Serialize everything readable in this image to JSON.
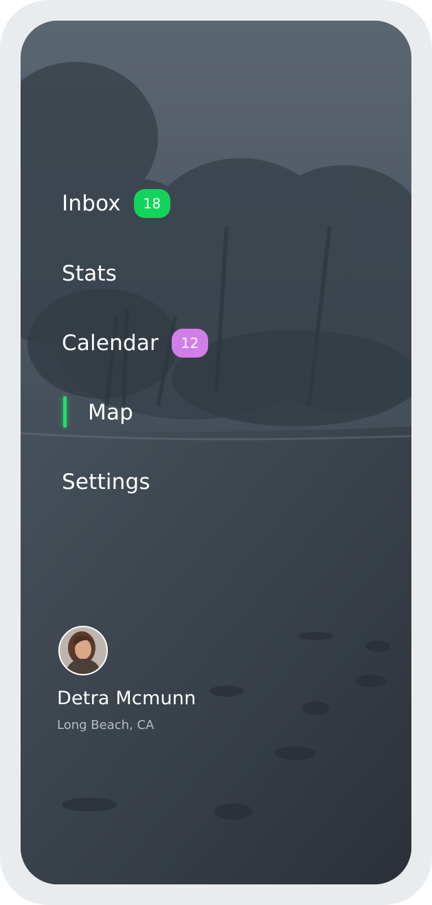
{
  "menu": {
    "items": [
      {
        "label": "Inbox",
        "badge": "18",
        "badge_color": "#14d35c"
      },
      {
        "label": "Stats"
      },
      {
        "label": "Calendar",
        "badge": "12",
        "badge_color": "#d27ee8"
      },
      {
        "label": "Map",
        "active": true
      },
      {
        "label": "Settings"
      }
    ],
    "active_indicator_color": "#22e06a"
  },
  "profile": {
    "name": "Detra Mcmunn",
    "location": "Long Beach, CA"
  }
}
